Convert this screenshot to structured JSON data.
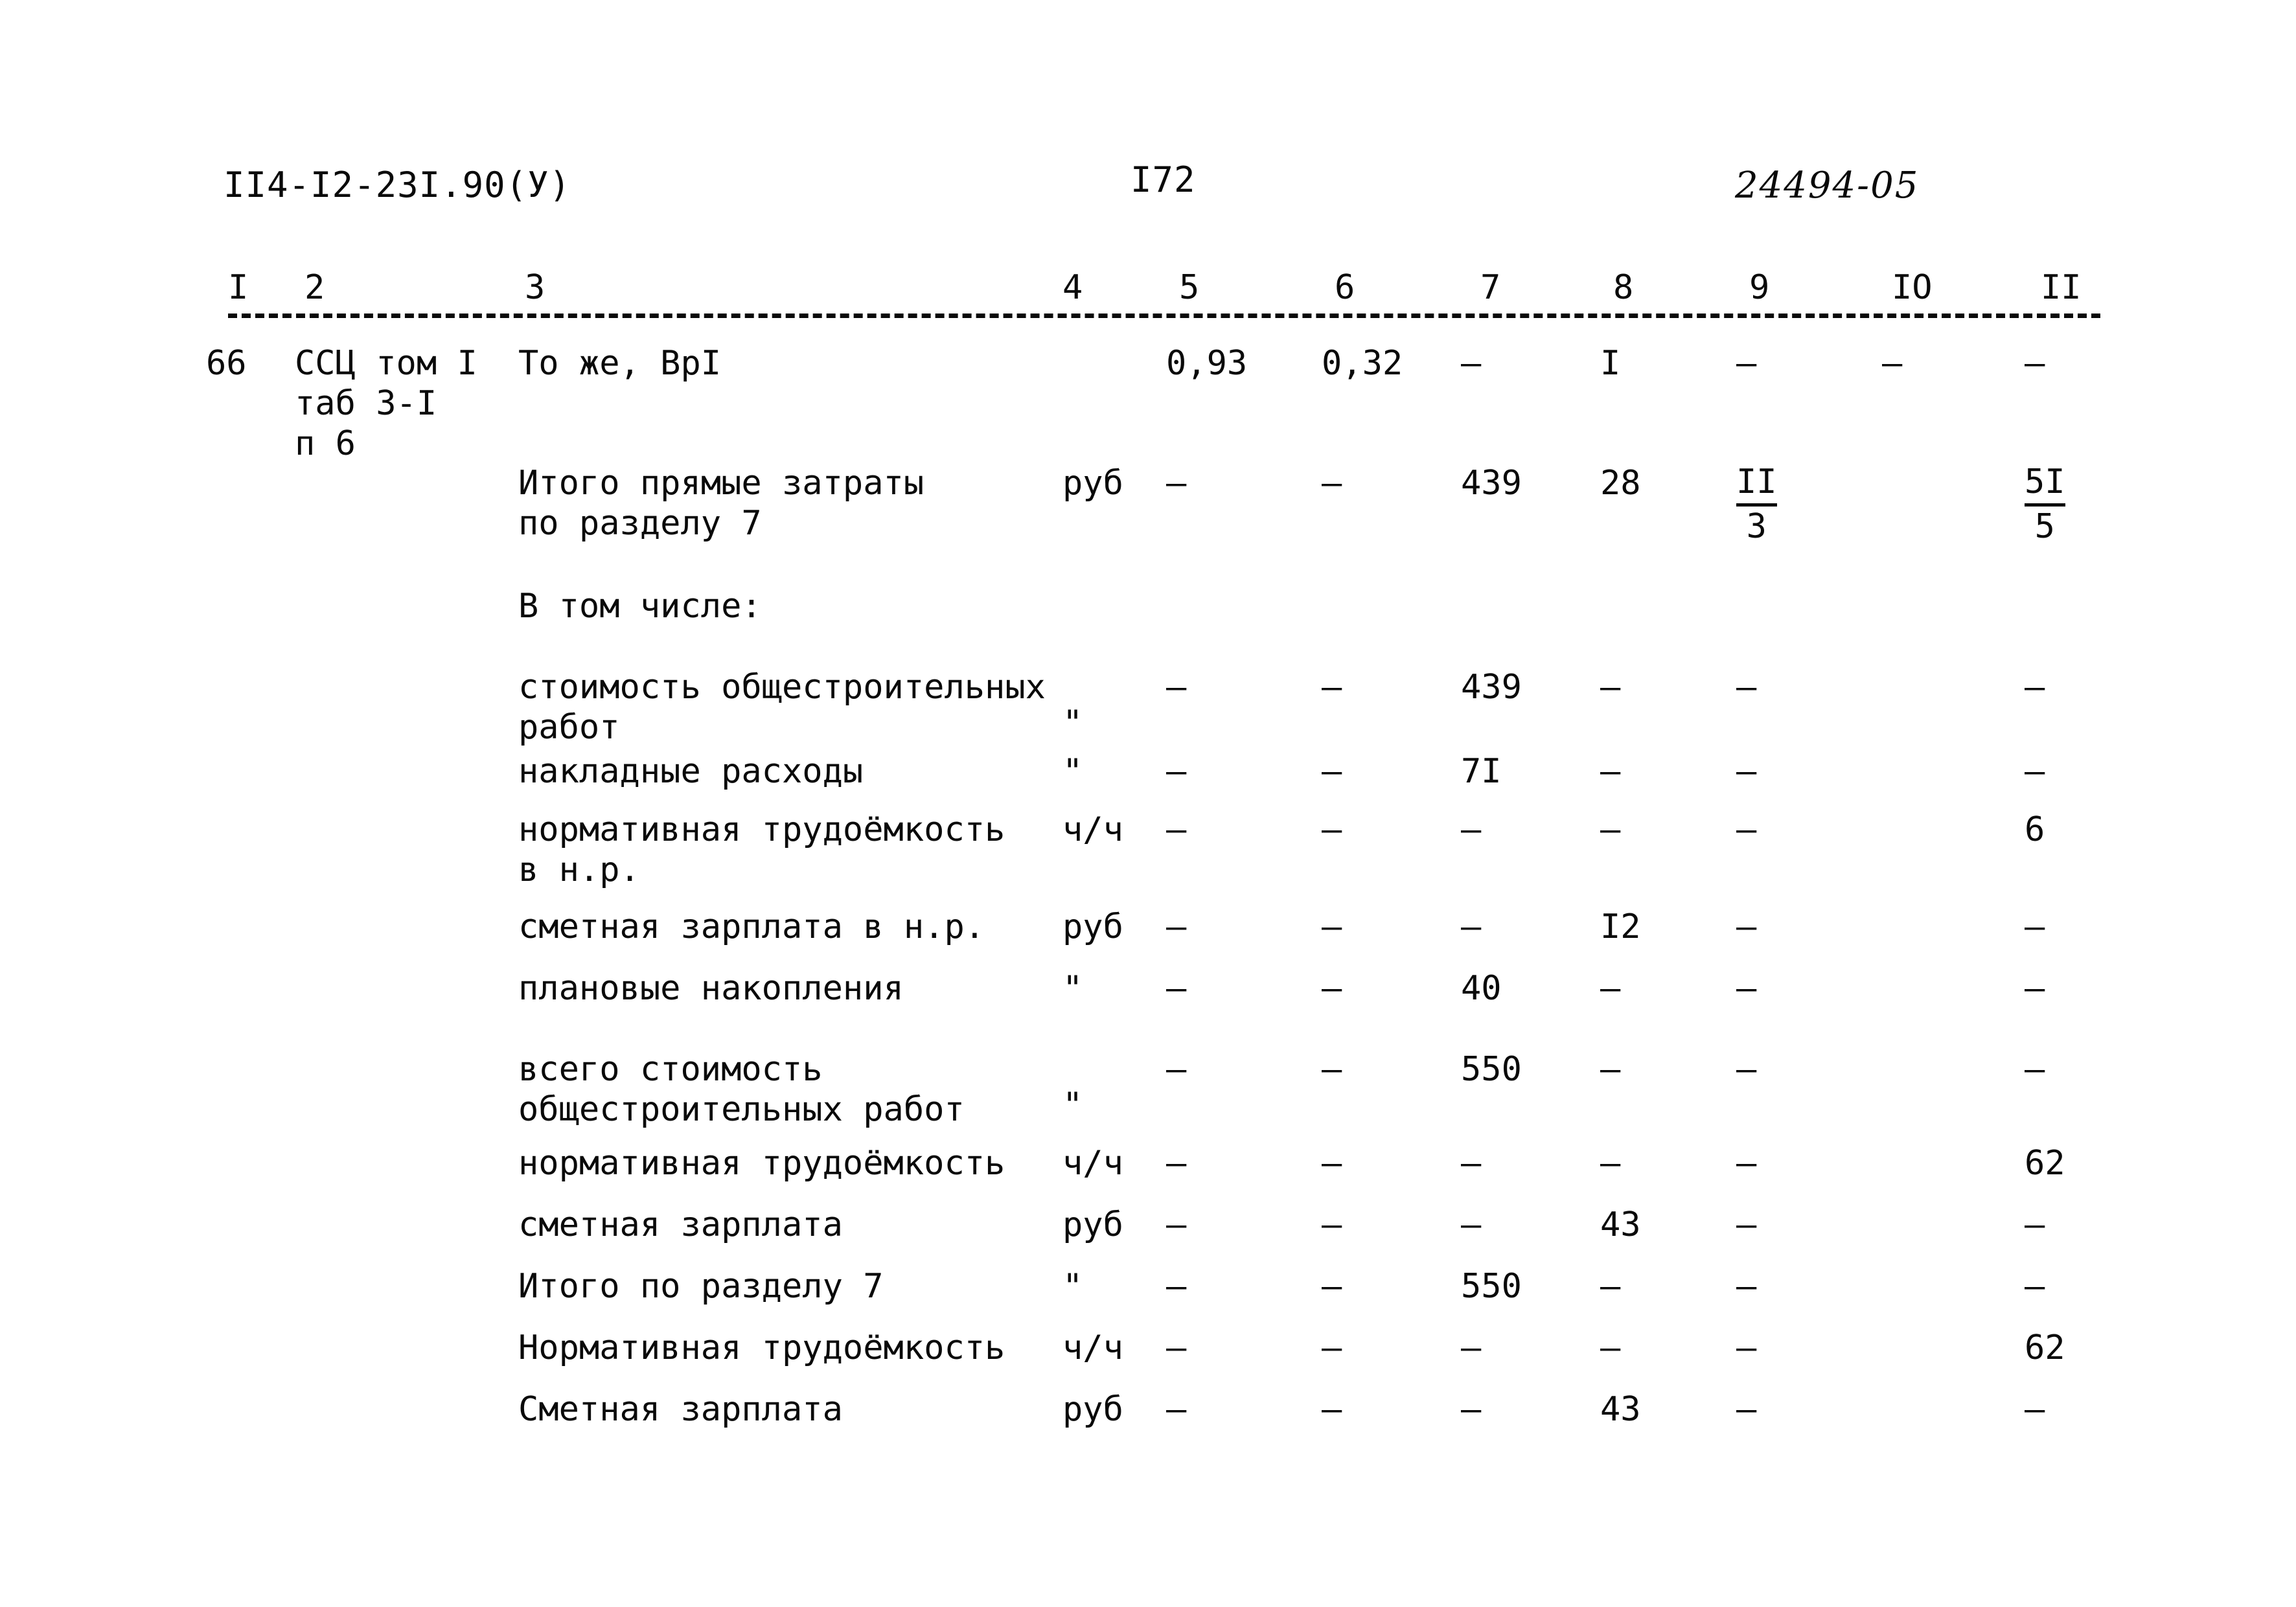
{
  "header": {
    "doc_code": "II4-I2-23I.90(У)",
    "page_number": "I72",
    "doc_ref": "24494-05"
  },
  "table": {
    "column_headers": [
      "I",
      "2",
      "3",
      "4",
      "5",
      "6",
      "7",
      "8",
      "9",
      "IO",
      "II"
    ],
    "rows": [
      {
        "num": "66",
        "justification": "ССЦ том I\nтаб 3-I\nп 6",
        "description": "То же, ВрI",
        "unit": "",
        "c5": "0,93",
        "c6": "0,32",
        "c7": "–",
        "c8": "I",
        "c9": "–",
        "c10": "–",
        "c11": "–",
        "c12": "–"
      },
      {
        "description": "Итого прямые затраты\nпо разделу 7",
        "unit": "руб",
        "c5": "–",
        "c6": "–",
        "c7": "439",
        "c8": "28",
        "c9_frac": {
          "num": "II",
          "den": "3"
        },
        "c10": "",
        "c11_frac": {
          "num": "5I",
          "den": "5"
        }
      },
      {
        "description": "В том числе:"
      },
      {
        "description": "стоимость общестроительных\nработ",
        "unit": "\"",
        "c5": "–",
        "c6": "–",
        "c7": "439",
        "c8": "–",
        "c9": "–",
        "c10": "",
        "c11": "–"
      },
      {
        "description": "накладные расходы",
        "unit": "\"",
        "c5": "–",
        "c6": "–",
        "c7": "7I",
        "c8": "–",
        "c9": "–",
        "c10": "",
        "c11": "–"
      },
      {
        "description": "нормативная трудоёмкость\nв н.р.",
        "unit": "ч/ч",
        "c5": "–",
        "c6": "–",
        "c7": "–",
        "c8": "–",
        "c9": "–",
        "c10": "",
        "c11": "6"
      },
      {
        "description": "сметная зарплата в н.р.",
        "unit": "руб",
        "c5": "–",
        "c6": "–",
        "c7": "–",
        "c8": "I2",
        "c9": "–",
        "c10": "",
        "c11": "–"
      },
      {
        "description": "плановые накопления",
        "unit": "\"",
        "c5": "–",
        "c6": "–",
        "c7": "40",
        "c8": "–",
        "c9": "–",
        "c10": "",
        "c11": "–"
      },
      {
        "description": "всего стоимость\nобщестроительных работ",
        "unit": "\"",
        "c5": "–",
        "c6": "–",
        "c7": "550",
        "c8": "–",
        "c9": "–",
        "c10": "",
        "c11": "–"
      },
      {
        "description": "нормативная трудоёмкость",
        "unit": "ч/ч",
        "c5": "–",
        "c6": "–",
        "c7": "–",
        "c8": "–",
        "c9": "–",
        "c10": "",
        "c11": "62"
      },
      {
        "description": "сметная зарплата",
        "unit": "руб",
        "c5": "–",
        "c6": "–",
        "c7": "–",
        "c8": "43",
        "c9": "–",
        "c10": "",
        "c11": "–"
      },
      {
        "description": "Итого по разделу 7",
        "unit": "\"",
        "c5": "–",
        "c6": "–",
        "c7": "550",
        "c8": "–",
        "c9": "–",
        "c10": "",
        "c11": "–"
      },
      {
        "description": "Нормативная трудоёмкость",
        "unit": "ч/ч",
        "c5": "–",
        "c6": "–",
        "c7": "–",
        "c8": "–",
        "c9": "–",
        "c10": "",
        "c11": "62"
      },
      {
        "description": "Сметная зарплата",
        "unit": "руб",
        "c5": "–",
        "c6": "–",
        "c7": "–",
        "c8": "43",
        "c9": "–",
        "c10": "",
        "c11": "–"
      }
    ]
  }
}
